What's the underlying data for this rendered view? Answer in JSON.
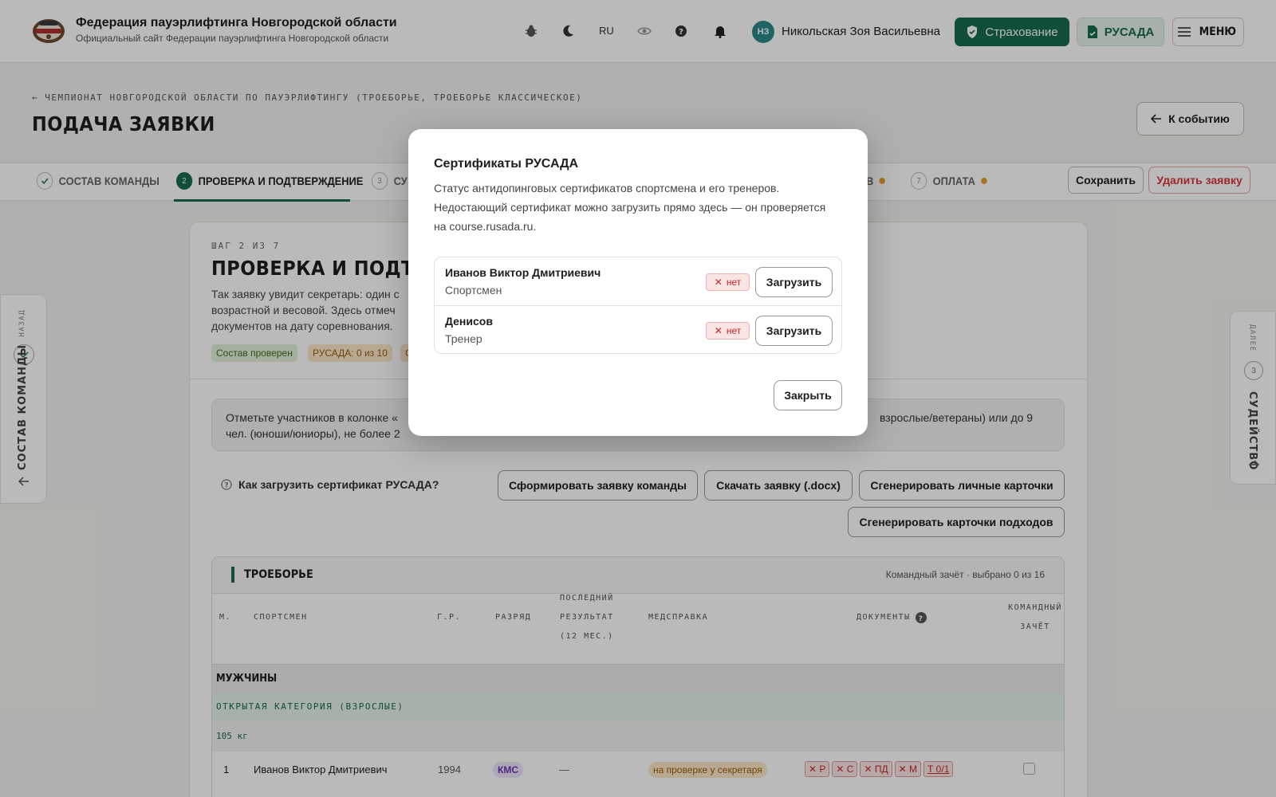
{
  "header": {
    "title": "Федерация пауэрлифтинга Новгородской области",
    "subtitle": "Официальный сайт Федерации пауэрлифтинга Новгородской области",
    "lang": "RU",
    "user_initials": "НЗ",
    "user_name": "Никольская Зоя Васильевна",
    "insurance_label": "Страхование",
    "rusada_label": "РУСАДА",
    "menu_label": "МЕНЮ"
  },
  "page": {
    "breadcrumb": "ЧЕМПИОНАТ НОВГОРОДСКОЙ ОБЛАСТИ ПО ПАУЭРЛИФТИНГУ (ТРОЕБОРЬЕ, ТРОЕБОРЬЕ КЛАССИЧЕСКОЕ)",
    "title": "ПОДАЧА ЗАЯВКИ",
    "to_event_label": "К событию"
  },
  "steps": [
    {
      "num": "✓",
      "label": "СОСТАВ КОМАНДЫ"
    },
    {
      "num": "2",
      "label": "ПРОВЕРКА И ПОДТВЕРЖДЕНИЕ"
    },
    {
      "num": "3",
      "label": "СУ"
    },
    {
      "num": "",
      "label": "В"
    },
    {
      "num": "7",
      "label": "ОПЛАТА"
    }
  ],
  "actions": {
    "save": "Сохранить",
    "delete": "Удалить заявку"
  },
  "main": {
    "step_of": "ШАГ 2 ИЗ 7",
    "heading": "ПРОВЕРКА И ПОДТВЕРЖ",
    "desc_1": "Так заявку увидит секретарь: один с",
    "desc_2": "возрастной и весовой. Здесь отмеч",
    "desc_3": "документов на дату соревнования.",
    "chip_1": "Состав проверен",
    "chip_2": "РУСАДА: 0 из 10",
    "chip_3": "С",
    "notice_1a": "Отметьте участников в колонке «",
    "notice_1b": "взрослые/ветераны) или до 9",
    "notice_2": "чел. (юноши/юниоры), не более 2",
    "help": "Как загрузить сертификат РУСАДА?",
    "btn_team": "Сформировать заявку команды",
    "btn_docx": "Скачать заявку (.docx)",
    "btn_cards": "Сгенерировать личные карточки",
    "btn_attempts": "Сгенерировать карточки подходов"
  },
  "table": {
    "title": "ТРОЕБОРЬЕ",
    "meta": "Командный зачёт · выбрано 0 из 16",
    "headers": {
      "m": "М.",
      "athlete": "СПОРТСМЕН",
      "year": "Г.Р.",
      "rank": "РАЗРЯД",
      "last_1": "ПОСЛЕДНИЙ",
      "last_2": "РЕЗУЛЬТАТ",
      "last_3": "(12 МЕС.)",
      "med": "МЕДСПРАВКА",
      "docs": "ДОКУМЕНТЫ",
      "team_1": "КОМАНДНЫЙ",
      "team_2": "ЗАЧЁТ"
    },
    "group": "МУЖЧИНЫ",
    "category": "ОТКРЫТАЯ КАТЕГОРИЯ (ВЗРОСЛЫЕ)",
    "weight": "105 кг",
    "row": {
      "place": "1",
      "name": "Иванов Виктор Дмитриевич",
      "year": "1994",
      "rank": "КМС",
      "last": "—",
      "med": "на проверке у секретаря",
      "docs": [
        "Р",
        "С",
        "ПД",
        "М"
      ],
      "t": "Т 0/1"
    }
  },
  "side": {
    "left_small": "НАЗАД",
    "left_big": "СОСТАВ КОМАНДЫ",
    "right_small": "ДАЛЕЕ",
    "right_num": "3",
    "right_big": "СУДЕЙСТВО"
  },
  "modal": {
    "title": "Сертификаты РУСАДА",
    "desc": "Статус антидопинговых сертификатов спортсмена и его тренеров. Недостающий сертификат можно загрузить прямо здесь — он проверяется на course.rusada.ru.",
    "rows": [
      {
        "name": "Иванов Виктор Дмитриевич",
        "role": "Спортсмен",
        "status": "нет",
        "action": "Загрузить"
      },
      {
        "name": "Денисов",
        "role": "Тренер",
        "status": "нет",
        "action": "Загрузить"
      }
    ],
    "close": "Закрыть"
  },
  "colors": {
    "accent": "#176b4c",
    "danger": "#d9363e",
    "warning": "#e6a02b"
  },
  "icons": [
    "logo-emblem",
    "bug-icon",
    "moon-icon",
    "eye-icon",
    "help-icon",
    "bell-icon",
    "shield-icon",
    "file-icon",
    "hamburger-icon",
    "arrow-left-icon",
    "arrow-right-icon",
    "check-icon",
    "close-x-icon"
  ]
}
